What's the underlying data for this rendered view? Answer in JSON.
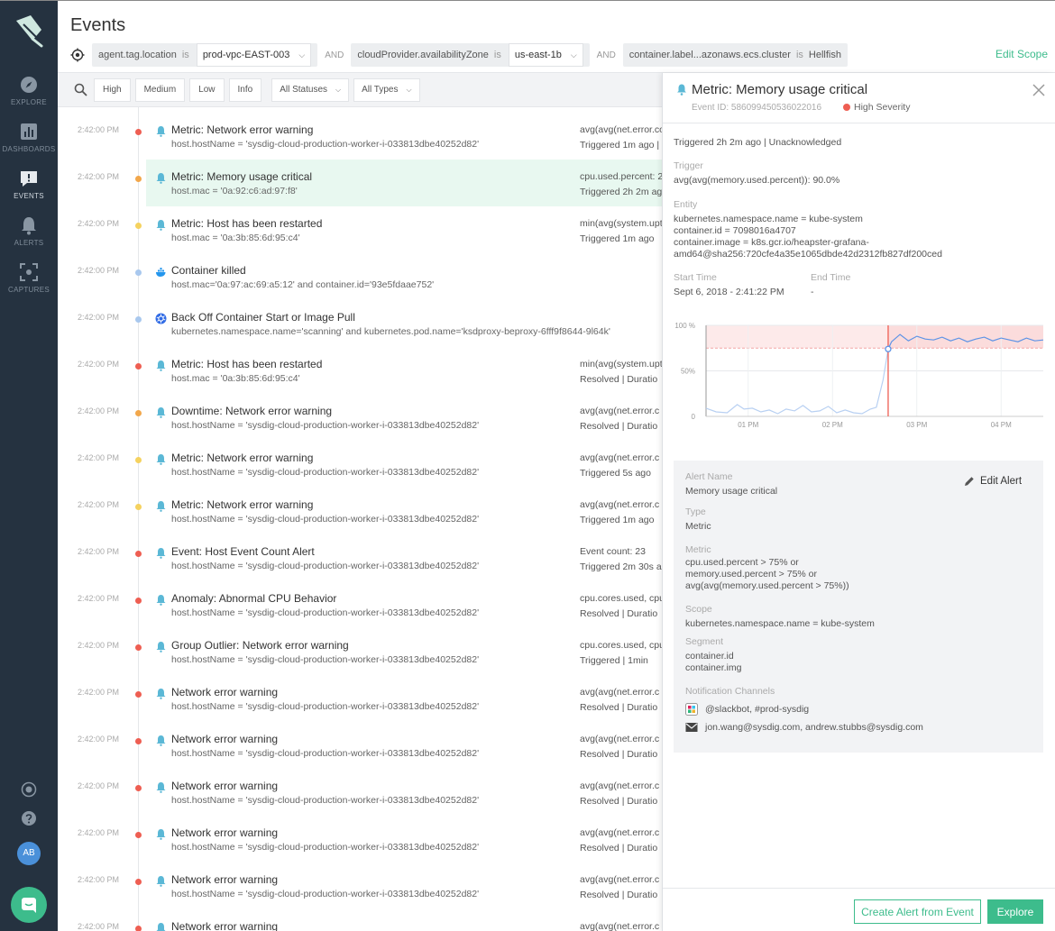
{
  "nav": {
    "explore": "EXPLORE",
    "dashboards": "DASHBOARDS",
    "events": "EVENTS",
    "alerts": "ALERTS",
    "captures": "CAPTURES",
    "avatar": "AB"
  },
  "header": {
    "title": "Events",
    "edit_scope": "Edit Scope",
    "and": "AND",
    "is": "is",
    "scope": [
      {
        "key": "agent.tag.location",
        "value": "prod-vpc-EAST-003"
      },
      {
        "key": "cloudProvider.availabilityZone",
        "value": "us-east-1b"
      },
      {
        "key": "container.label...azonaws.ecs.cluster",
        "value": "Hellfish"
      }
    ]
  },
  "filters": {
    "high": "High",
    "medium": "Medium",
    "low": "Low",
    "info": "Info",
    "statuses": "All Statuses",
    "types": "All Types"
  },
  "colors": {
    "high": "#ee5e52",
    "medium": "#f2a74b",
    "low": "#f5d25f",
    "info": "#a9c8ee",
    "accent": "#3dbc8c",
    "nav": "#253240"
  },
  "events": [
    {
      "time": "2:42:00 PM",
      "severity": "high",
      "icon": "bell-icon",
      "title": "Metric: Network error warning",
      "sub": "host.hostName = 'sysdig-cloud-production-worker-i-033813dbe40252d82'",
      "m1": "avg(avg(net.error.co",
      "m2": "Triggered 1m ago  |"
    },
    {
      "time": "2:42:00 PM",
      "severity": "medium",
      "icon": "bell-icon",
      "title": "Metric: Memory usage critical",
      "sub": "host.mac = '0a:92:c6:ad:97:f8'",
      "m1": "cpu.used.percent: 2",
      "m2": "Triggered 2h 2m ag",
      "selected": true
    },
    {
      "time": "2:42:00 PM",
      "severity": "low",
      "icon": "bell-icon",
      "title": "Metric: Host has been restarted",
      "sub": "host.mac = '0a:3b:85:6d:95:c4'",
      "m1": "min(avg(system.upt",
      "m2": "Triggered 1m ago"
    },
    {
      "time": "2:42:00 PM",
      "severity": "info",
      "icon": "docker-icon",
      "title": "Container killed",
      "sub": "host.mac='0a:97:ac:69:a5:12' and container.id='93e5fdaae752'",
      "m1": "",
      "m2": ""
    },
    {
      "time": "2:42:00 PM",
      "severity": "info",
      "icon": "kubernetes-icon",
      "title": "Back Off Container Start or Image Pull",
      "sub": "kubernetes.namespace.name='scanning' and kubernetes.pod.name='ksdproxy-beproxy-6fff9f8644-9l64k'",
      "m1": "",
      "m2": ""
    },
    {
      "time": "2:42:00 PM",
      "severity": "high",
      "icon": "bell-icon",
      "title": "Metric: Host has been restarted",
      "sub": "host.mac = '0a:3b:85:6d:95:c4'",
      "m1": "min(avg(system.upt",
      "m2": "Resolved  |  Duratio"
    },
    {
      "time": "2:42:00 PM",
      "severity": "medium",
      "icon": "bell-icon",
      "title": "Downtime: Network error warning",
      "sub": "host.hostName = 'sysdig-cloud-production-worker-i-033813dbe40252d82'",
      "m1": "avg(avg(net.error.c",
      "m2": "Resolved  |  Duratio"
    },
    {
      "time": "2:42:00 PM",
      "severity": "low",
      "icon": "bell-icon",
      "title": "Metric: Network error warning",
      "sub": "host.hostName = 'sysdig-cloud-production-worker-i-033813dbe40252d82'",
      "m1": "avg(avg(net.error.c",
      "m2": "Triggered 5s ago"
    },
    {
      "time": "2:42:00 PM",
      "severity": "low",
      "icon": "bell-icon",
      "title": "Metric: Network error warning",
      "sub": "host.hostName = 'sysdig-cloud-production-worker-i-033813dbe40252d82'",
      "m1": "avg(avg(net.error.c",
      "m2": "Triggered 1m ago"
    },
    {
      "time": "2:42:00 PM",
      "severity": "high",
      "icon": "bell-icon",
      "title": "Event: Host Event Count Alert",
      "sub": "host.hostName = 'sysdig-cloud-production-worker-i-033813dbe40252d82'",
      "m1": "Event count: 23",
      "m2": "Triggered 2m 30s a"
    },
    {
      "time": "2:42:00 PM",
      "severity": "high",
      "icon": "bell-icon",
      "title": "Anomaly: Abnormal CPU Behavior",
      "sub": "host.hostName = 'sysdig-cloud-production-worker-i-033813dbe40252d82'",
      "m1": "cpu.cores.used, cpu",
      "m2": "Resolved  |  Duratio"
    },
    {
      "time": "2:42:00 PM",
      "severity": "high",
      "icon": "bell-icon",
      "title": "Group Outlier: Network error warning",
      "sub": "host.hostName = 'sysdig-cloud-production-worker-i-033813dbe40252d82'",
      "m1": "cpu.cores.used, cpu",
      "m2": "Triggered | 1min"
    },
    {
      "time": "2:42:00 PM",
      "severity": "high",
      "icon": "bell-icon",
      "title": "Network error warning",
      "sub": "host.hostName = 'sysdig-cloud-production-worker-i-033813dbe40252d82'",
      "m1": "avg(avg(net.error.c",
      "m2": "Resolved  |  Duratio"
    },
    {
      "time": "2:42:00 PM",
      "severity": "high",
      "icon": "bell-icon",
      "title": "Network error warning",
      "sub": "host.hostName = 'sysdig-cloud-production-worker-i-033813dbe40252d82'",
      "m1": "avg(avg(net.error.c",
      "m2": "Resolved  |  Duratio"
    },
    {
      "time": "2:42:00 PM",
      "severity": "high",
      "icon": "bell-icon",
      "title": "Network error warning",
      "sub": "host.hostName = 'sysdig-cloud-production-worker-i-033813dbe40252d82'",
      "m1": "avg(avg(net.error.c",
      "m2": "Resolved  |  Duratio"
    },
    {
      "time": "2:42:00 PM",
      "severity": "high",
      "icon": "bell-icon",
      "title": "Network error warning",
      "sub": "host.hostName = 'sysdig-cloud-production-worker-i-033813dbe40252d82'",
      "m1": "avg(avg(net.error.c",
      "m2": "Resolved  |  Duratio"
    },
    {
      "time": "2:42:00 PM",
      "severity": "high",
      "icon": "bell-icon",
      "title": "Network error warning",
      "sub": "host.hostName = 'sysdig-cloud-production-worker-i-033813dbe40252d82'",
      "m1": "avg(avg(net.error.c",
      "m2": "Resolved  |  Duratio"
    },
    {
      "time": "2:42:00 PM",
      "severity": "high",
      "icon": "bell-icon",
      "title": "Network error warning",
      "sub": "",
      "m1": "avg(avg(net.error.c",
      "m2": ""
    }
  ],
  "detail": {
    "title": "Metric: Memory usage critical",
    "event_id": "Event ID: 586099450536022016",
    "severity": "High Severity",
    "status": "Triggered 2h 2m ago  |  Unacknowledged",
    "trigger_label": "Trigger",
    "trigger": "avg(avg(memory.used.percent)): 90.0%",
    "entity_label": "Entity",
    "entity": [
      "kubernetes.namespace.name = kube-system",
      "container.id = 7098016a4707",
      "container.image = k8s.gcr.io/heapster-grafana-",
      "amd64@sha256:720cfe4a35e1065dbde42d2312fb827df200ced"
    ],
    "start_label": "Start Time",
    "start": "Sept 6, 2018 - 2:41:22 PM",
    "end_label": "End Time",
    "end": "-",
    "alert": {
      "name_label": "Alert Name",
      "name": "Memory usage critical",
      "edit": "Edit Alert",
      "type_label": "Type",
      "type": "Metric",
      "metric_label": "Metric",
      "metric": [
        "cpu.used.percent > 75%  or",
        "memory.used.percent > 75% or",
        "avg(avg(memory.used.percent > 75%))"
      ],
      "scope_label": "Scope",
      "scope": "kubernetes.namespace.name = kube-system",
      "segment_label": "Segment",
      "segment": [
        "container.id",
        "container.img"
      ],
      "channels_label": "Notification Channels",
      "slack": "@slackbot, #prod-sysdig",
      "email": "jon.wang@sysdig.com, andrew.stubbs@sysdig.com"
    },
    "buttons": {
      "create": "Create Alert from Event",
      "explore": "Explore"
    }
  },
  "chart_data": {
    "type": "line",
    "x_ticks": [
      "01 PM",
      "02 PM",
      "03 PM",
      "04 PM"
    ],
    "y_ticks": [
      "100 %",
      "50%",
      "0"
    ],
    "ylim": [
      0,
      100
    ],
    "xlim": [
      12.5,
      16.5
    ],
    "threshold": 75,
    "event_x": 14.66,
    "series": [
      {
        "x": [
          12.5,
          12.62,
          12.75,
          12.87,
          12.95,
          13.05,
          13.15,
          13.25,
          13.35,
          13.45,
          13.55,
          13.65,
          13.75,
          13.85,
          13.95,
          14.05,
          14.15,
          14.25,
          14.35,
          14.45,
          14.52,
          14.6,
          14.66,
          14.7,
          14.8,
          14.9,
          15.0,
          15.1,
          15.2,
          15.3,
          15.4,
          15.5,
          15.6,
          15.7,
          15.8,
          15.9,
          16.0,
          16.1,
          16.2,
          16.3,
          16.4,
          16.5
        ],
        "y": [
          9,
          5,
          4,
          13,
          8,
          9,
          5,
          7,
          3,
          8,
          6,
          12,
          5,
          6,
          11,
          4,
          7,
          4,
          3,
          8,
          10,
          40,
          74,
          82,
          90,
          83,
          88,
          85,
          84,
          87,
          83,
          86,
          82,
          85,
          87,
          83,
          86,
          84,
          82,
          86,
          83,
          84
        ]
      }
    ]
  }
}
